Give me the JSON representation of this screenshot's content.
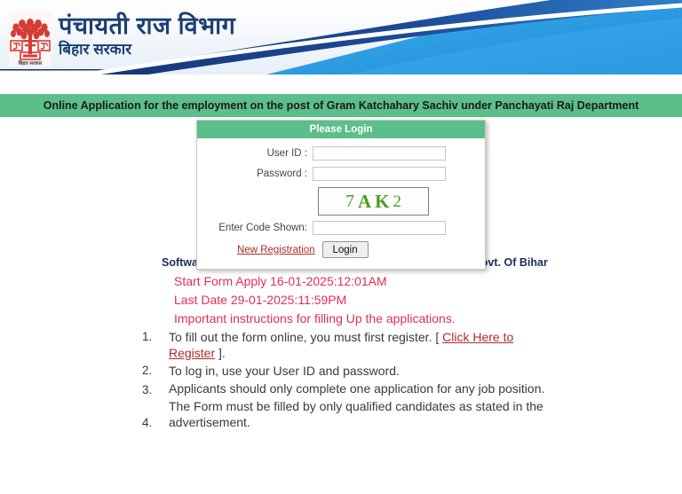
{
  "header": {
    "emblem_alt": "bihar-government-emblem",
    "emblem_caption": "बिहार सरकार",
    "title_main": "पंचायती राज विभाग",
    "title_sub": "बिहार सरकार",
    "brand_color": "#1b3f73",
    "wave_dark": "#1b3b7a",
    "wave_mid": "#1e7fd0",
    "wave_light": "#2aa3e8"
  },
  "banner": {
    "text": "Online Application for the employment on the post of Gram Katchahary Sachiv under Panchayati Raj Department",
    "background": "#5cbf8a",
    "text_color": "#1a1a1a"
  },
  "login": {
    "title": "Please Login",
    "title_background": "#5cbf8a",
    "user_id_label": "User ID :",
    "user_id_value": "",
    "user_id_placeholder": "",
    "password_label": "Password :",
    "password_value": "",
    "password_placeholder": "",
    "captcha": {
      "characters": [
        "7",
        "A",
        "K",
        "2"
      ],
      "text": "7AK2",
      "color": "#4f9b1e"
    },
    "code_label": "Enter Code Shown:",
    "code_value": "",
    "code_placeholder": "",
    "new_registration_label": "New Registration",
    "login_button_label": "Login",
    "link_color": "#b02a2a"
  },
  "info": {
    "software_line": "Software Solution Provided by Panchayat Raj Department, Govt. Of Bihar",
    "start_date_line": "Start Form Apply 16-01-2025:12:01AM",
    "last_date_line": "Last Date 29-01-2025:11:59PM",
    "instructions_heading": "Important instructions for filling Up the applications.",
    "red_color": "#e03050",
    "items": [
      {
        "num": "1.",
        "text_before": "To fill out the form online, you must first register. [ ",
        "link": "Click Here to Register",
        "text_after": "  ]."
      },
      {
        "num": "2.",
        "text_before": "To log in, use your User ID and password.",
        "link": "",
        "text_after": ""
      },
      {
        "num": "3.",
        "text_before": "Applicants should only complete one application for any job position.",
        "link": "",
        "text_after": ""
      },
      {
        "num": "4.",
        "text_before": "The Form must be filled by only qualified candidates as stated in the advertisement.",
        "link": "",
        "text_after": ""
      }
    ]
  }
}
